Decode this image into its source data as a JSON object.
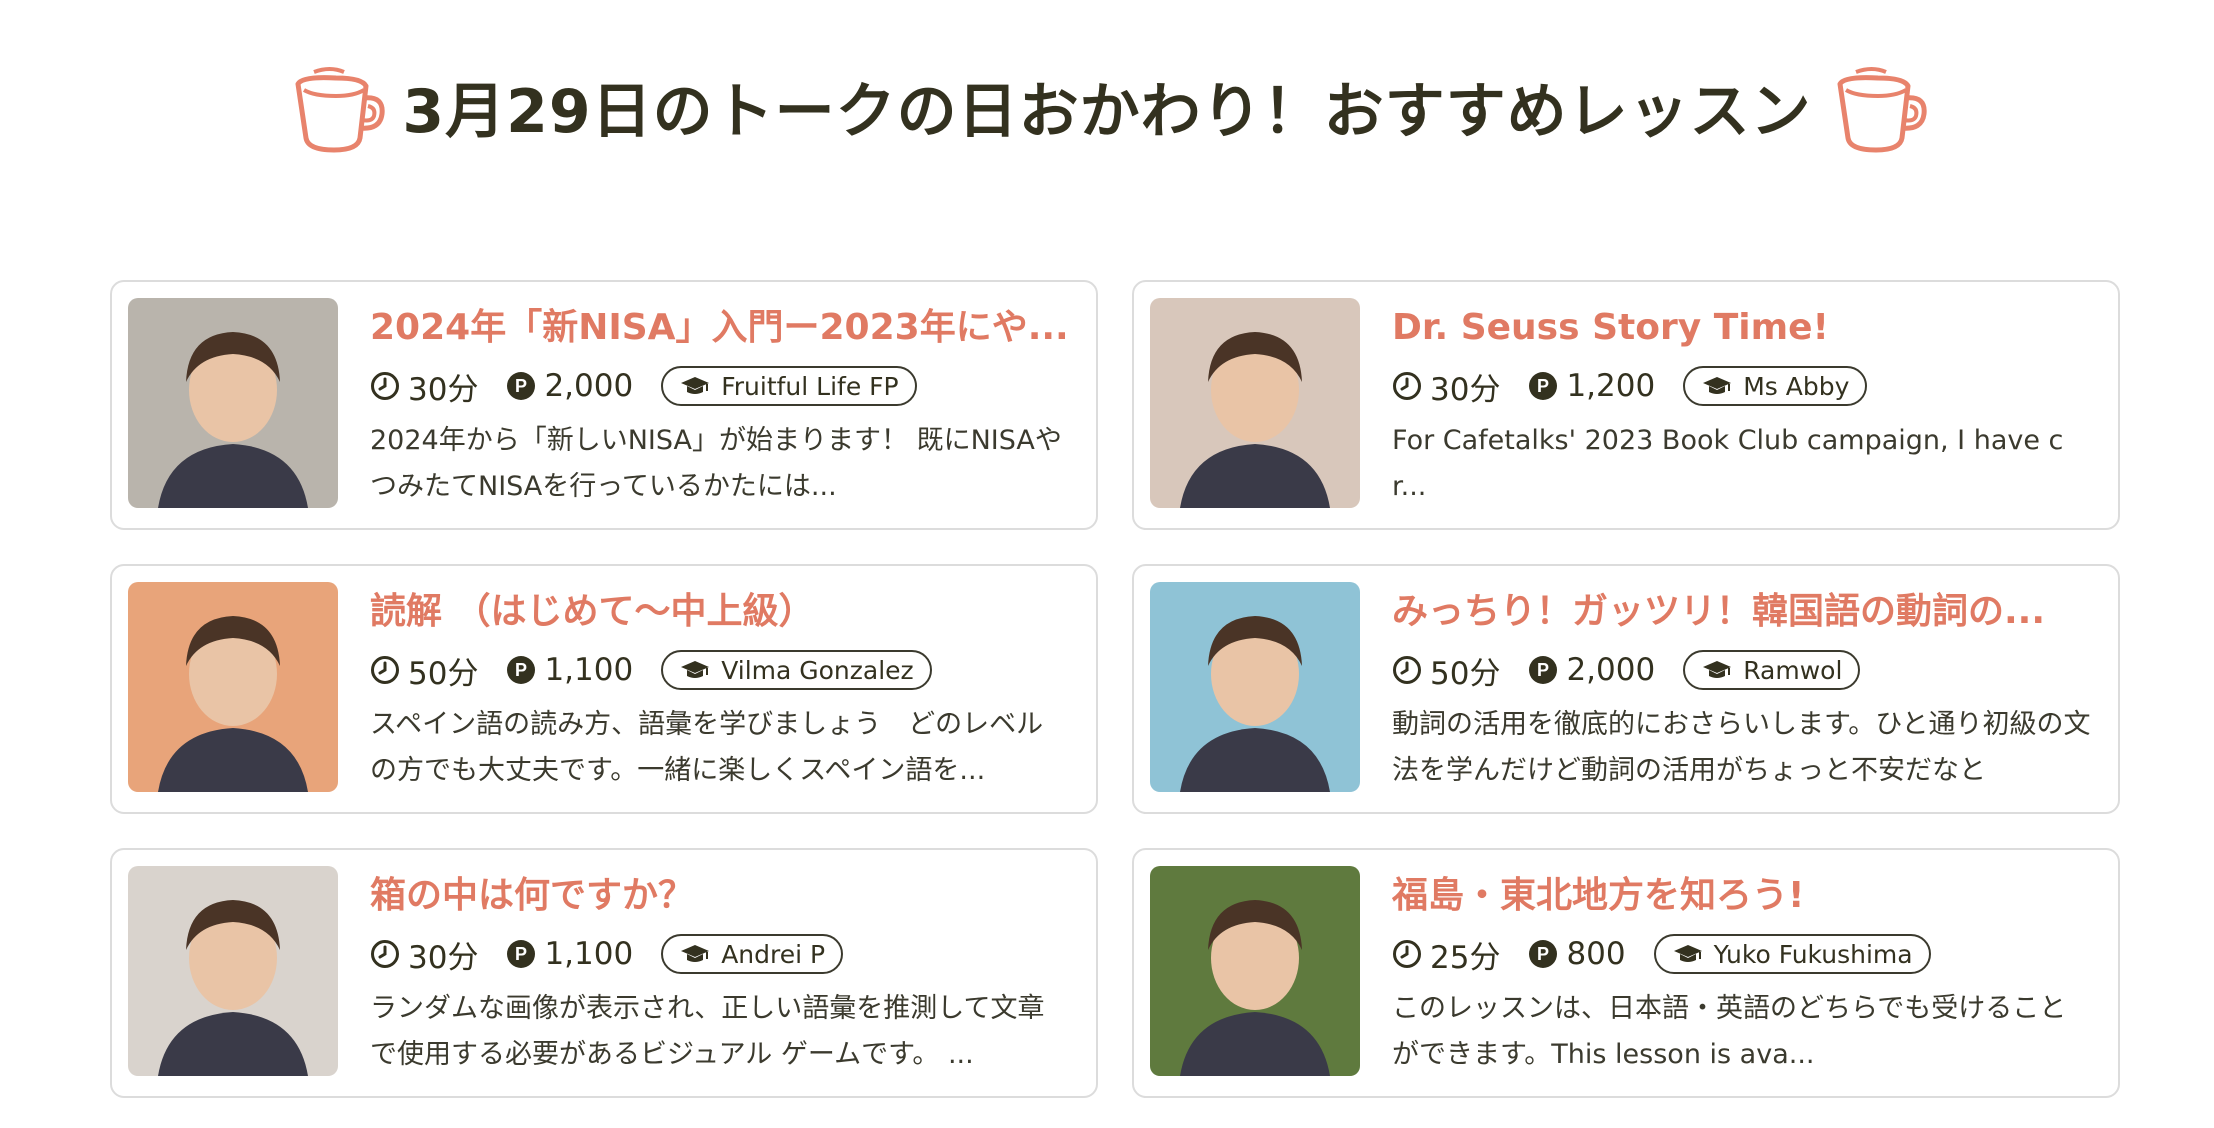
{
  "page": {
    "title": "3月29日のトークの日おかわり！おすすめレッスン",
    "accent_color": "#e07a63",
    "text_color": "#33311f"
  },
  "icons": {
    "header_left": "coffee-cup-icon",
    "header_right": "coffee-cup-icon",
    "duration": "clock-icon",
    "price": "points-icon",
    "tutor": "graduation-cap-icon"
  },
  "lessons": [
    {
      "title": "2024年「新NISA」入門ー2023年にや...",
      "duration": "30分",
      "price": "2,000",
      "tutor": "Fruitful Life FP",
      "description": "2024年から「新しいNISA」が始まります！ 既にNISAやつみたてNISAを行っているかたには...",
      "thumb_color": "#b9b4ac"
    },
    {
      "title": "Dr. Seuss Story Time!",
      "duration": "30分",
      "price": "1,200",
      "tutor": "Ms Abby",
      "description": "For Cafetalks' 2023 Book Club campaign, I have cr...",
      "thumb_color": "#d8c7bb"
    },
    {
      "title": "読解 （はじめて〜中上級）",
      "duration": "50分",
      "price": "1,100",
      "tutor": "Vilma Gonzalez",
      "description": "スペイン語の読み方、語彙を学びましょう　どのレベルの方でも大丈夫です。一緒に楽しくスペイン語を...",
      "thumb_color": "#e8a47a"
    },
    {
      "title": "みっちり！ガッツリ！韓国語の動詞の...",
      "duration": "50分",
      "price": "2,000",
      "tutor": "Ramwol",
      "description": "動詞の活用を徹底的におさらいします。ひと通り初級の文法を学んだけど動詞の活用がちょっと不安だなと",
      "thumb_color": "#8fc3d6"
    },
    {
      "title": "箱の中は何ですか？",
      "duration": "30分",
      "price": "1,100",
      "tutor": "Andrei P",
      "description": "ランダムな画像が表示され、正しい語彙を推測して文章で使用する必要があるビジュアル ゲームです。 ...",
      "thumb_color": "#d9d3cd"
    },
    {
      "title": "福島・東北地方を知ろう!",
      "duration": "25分",
      "price": "800",
      "tutor": "Yuko Fukushima",
      "description": "このレッスンは、日本語・英語のどちらでも受けることができます。This lesson is ava...",
      "thumb_color": "#5f7a3e"
    }
  ]
}
